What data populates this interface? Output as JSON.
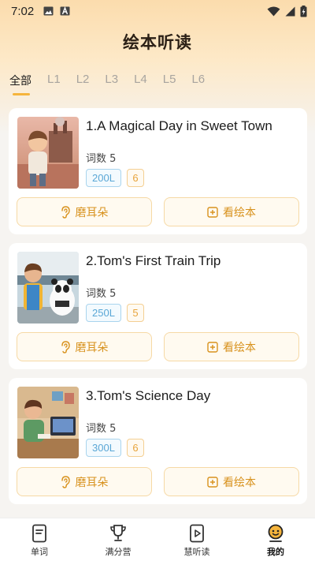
{
  "status_bar": {
    "time": "7:02"
  },
  "header": {
    "title": "绘本听读"
  },
  "tabs": [
    {
      "label": "全部",
      "active": true
    },
    {
      "label": "L1",
      "active": false
    },
    {
      "label": "L2",
      "active": false
    },
    {
      "label": "L3",
      "active": false
    },
    {
      "label": "L4",
      "active": false
    },
    {
      "label": "L5",
      "active": false
    },
    {
      "label": "L6",
      "active": false
    }
  ],
  "books": [
    {
      "title": "1.A Magical Day in Sweet Town",
      "word_count": "词数 5",
      "level": "200L",
      "number": "6"
    },
    {
      "title": "2.Tom's First Train Trip",
      "word_count": "词数 5",
      "level": "250L",
      "number": "5"
    },
    {
      "title": "3.Tom's Science Day",
      "word_count": "词数 5",
      "level": "300L",
      "number": "6"
    }
  ],
  "actions": {
    "listen_label": "磨耳朵",
    "read_label": "看绘本"
  },
  "bottom_nav": [
    {
      "label": "单词",
      "icon": "book-icon",
      "active": false
    },
    {
      "label": "满分营",
      "icon": "trophy-icon",
      "active": false
    },
    {
      "label": "慧听读",
      "icon": "video-book-icon",
      "active": false
    },
    {
      "label": "我的",
      "icon": "profile-face-icon",
      "active": true
    }
  ],
  "colors": {
    "accent": "#f5b43c",
    "button_text": "#d8921e",
    "level_blue": "#5aa7d6"
  }
}
